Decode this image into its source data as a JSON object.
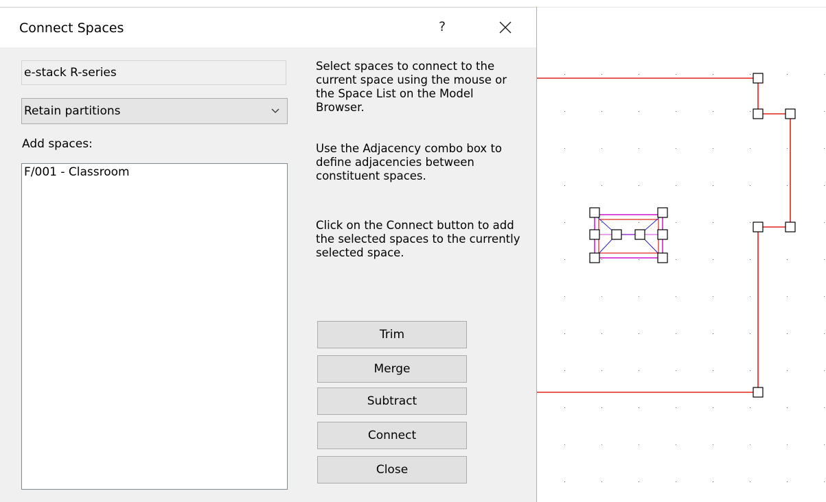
{
  "dialog": {
    "title": "Connect Spaces",
    "help_label": "?",
    "space_name": "e-stack R-series",
    "mode_select": {
      "selected": "Retain partitions"
    },
    "add_spaces_label": "Add spaces:",
    "spaces_list": [
      "F/001 - Classroom"
    ],
    "instructions": [
      "Select spaces to connect to the current space using the mouse or the Space List on the Model Browser.",
      "Use the Adjacency combo box to define adjacencies between constituent spaces.",
      "Click on the Connect button to add the selected spaces to the currently selected space."
    ],
    "buttons": {
      "trim": "Trim",
      "merge": "Merge",
      "subtract": "Subtract",
      "connect": "Connect",
      "close": "Close"
    }
  },
  "colors": {
    "wall_line": "#e0201c",
    "selected_space": "#cc00cc",
    "adjacency_line": "#2222cc",
    "grid_dot": "#777777"
  }
}
